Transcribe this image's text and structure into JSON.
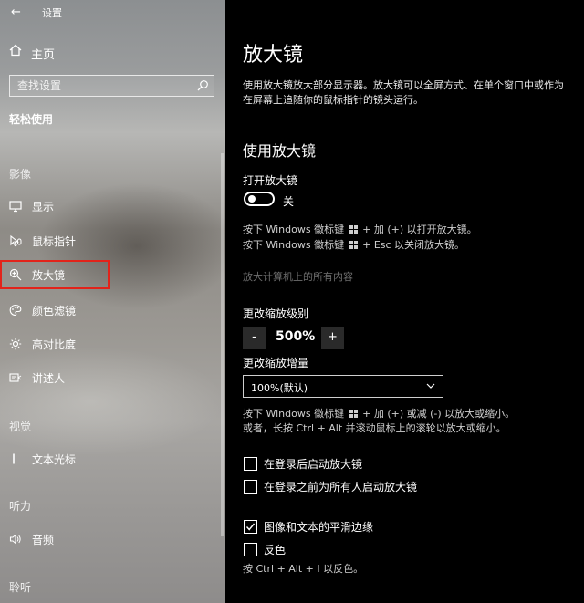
{
  "window": {
    "title": "设置",
    "back_glyph": "←"
  },
  "sidebar": {
    "home": "主页",
    "search_placeholder": "查找设置",
    "section": "轻松使用",
    "groups": {
      "vision": "影像",
      "sight": "视觉",
      "hearing": "听力",
      "hearing2": "聆听"
    },
    "items": [
      {
        "label": "显示",
        "icon": "display-icon"
      },
      {
        "label": "鼠标指针",
        "icon": "mouse-pointer-icon"
      },
      {
        "label": "放大镜",
        "icon": "magnifier-icon",
        "selected": true
      },
      {
        "label": "颜色滤镜",
        "icon": "palette-icon"
      },
      {
        "label": "高对比度",
        "icon": "contrast-icon"
      },
      {
        "label": "讲述人",
        "icon": "narrator-icon"
      },
      {
        "label": "文本光标",
        "icon": "text-cursor-icon"
      },
      {
        "label": "音频",
        "icon": "speaker-icon"
      }
    ],
    "colors": {
      "selected_border": "#e2231a"
    }
  },
  "main": {
    "title": "放大镜",
    "description": "使用放大镜放大部分显示器。放大镜可以全屏方式、在单个窗口中或作为在屏幕上追随你的鼠标指针的镜头运行。",
    "section_title": "使用放大镜",
    "toggle": {
      "label": "打开放大镜",
      "state": "关",
      "on": false
    },
    "shortcut_hint_1a": "按下 Windows 徽标键",
    "shortcut_hint_1b": "+ 加 (+) 以打开放大镜。",
    "shortcut_hint_2a": "按下 Windows 徽标键",
    "shortcut_hint_2b": "+ Esc 以关闭放大镜。",
    "disabled_option": "放大计算机上的所有内容",
    "zoom": {
      "label": "更改缩放级别",
      "minus": "-",
      "value": "500%",
      "plus": "+"
    },
    "increment": {
      "label": "更改缩放增量",
      "selected": "100%(默认)"
    },
    "zoom_hint_1a": "按下 Windows 徽标键",
    "zoom_hint_1b": "+ 加 (+) 或减 (-) 以放大或缩小。",
    "zoom_hint_2": "或者，长按 Ctrl + Alt 并滚动鼠标上的滚轮以放大或缩小。",
    "checkboxes": [
      {
        "label": "在登录后启动放大镜",
        "checked": false
      },
      {
        "label": "在登录之前为所有人启动放大镜",
        "checked": false
      },
      {
        "label": "图像和文本的平滑边缘",
        "checked": true
      },
      {
        "label": "反色",
        "checked": false
      }
    ],
    "invert_hint": "按 Ctrl + Alt + I 以反色。"
  }
}
